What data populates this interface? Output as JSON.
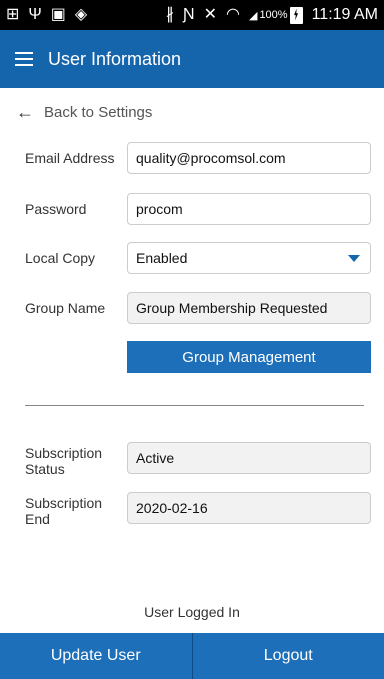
{
  "statusbar": {
    "icons": [
      "add-box-icon",
      "usb-icon",
      "image-icon",
      "shield-icon",
      "bluetooth-icon",
      "nfc-icon",
      "mute-icon",
      "wifi-icon",
      "signal-icon"
    ],
    "battery": "100%",
    "time": "11:19 AM"
  },
  "appbar": {
    "title": "User Information"
  },
  "back": {
    "label": "Back to Settings"
  },
  "form": {
    "email": {
      "label": "Email Address",
      "value": "quality@procomsol.com"
    },
    "password": {
      "label": "Password",
      "value": "procom"
    },
    "local_copy": {
      "label": "Local Copy",
      "value": "Enabled"
    },
    "group_name": {
      "label": "Group Name",
      "value": "Group Membership Requested"
    },
    "group_button": "Group Management",
    "subscription_status": {
      "label_line1": "Subscription",
      "label_line2": "Status",
      "value": "Active"
    },
    "subscription_end": {
      "label_line1": "Subscription",
      "label_line2": "End",
      "value": "2020-02-16"
    }
  },
  "status_text": "User Logged In",
  "bottom": {
    "update_label": "Update User",
    "logout_label": "Logout"
  }
}
